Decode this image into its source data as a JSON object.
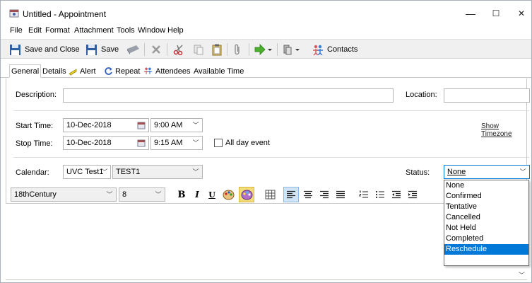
{
  "window": {
    "title": "Untitled - Appointment",
    "minimize": "—",
    "maximize": "☐",
    "close": "✕"
  },
  "menu": [
    "File",
    "Edit",
    "Format",
    "Attachment",
    "Tools",
    "Window",
    "Help"
  ],
  "toolbar": {
    "save_close": "Save and Close",
    "save": "Save",
    "contacts": "Contacts"
  },
  "tabs": [
    "General",
    "Details",
    "Alert",
    "Repeat",
    "Attendees",
    "Available Time"
  ],
  "form": {
    "description_label": "Description:",
    "description_value": "",
    "location_label": "Location:",
    "location_value": "",
    "start_label": "Start Time:",
    "start_date": "10-Dec-2018",
    "start_time": "9:00 AM",
    "stop_label": "Stop Time:",
    "stop_date": "10-Dec-2018",
    "stop_time": "9:15 AM",
    "all_day_label": "All day event",
    "show_timezone": "Show Timezone",
    "calendar_label": "Calendar:",
    "calendar_value": "UVC Test1",
    "calendar_sub": "TEST1",
    "status_label": "Status:",
    "status_value": "None"
  },
  "format": {
    "font": "18thCentury",
    "size": "8",
    "bold": "B",
    "italic": "I",
    "underline": "U"
  },
  "status_options": [
    "None",
    "Confirmed",
    "Tentative",
    "Cancelled",
    "Not Held",
    "Completed",
    "Reschedule"
  ],
  "status_highlighted": "Reschedule"
}
